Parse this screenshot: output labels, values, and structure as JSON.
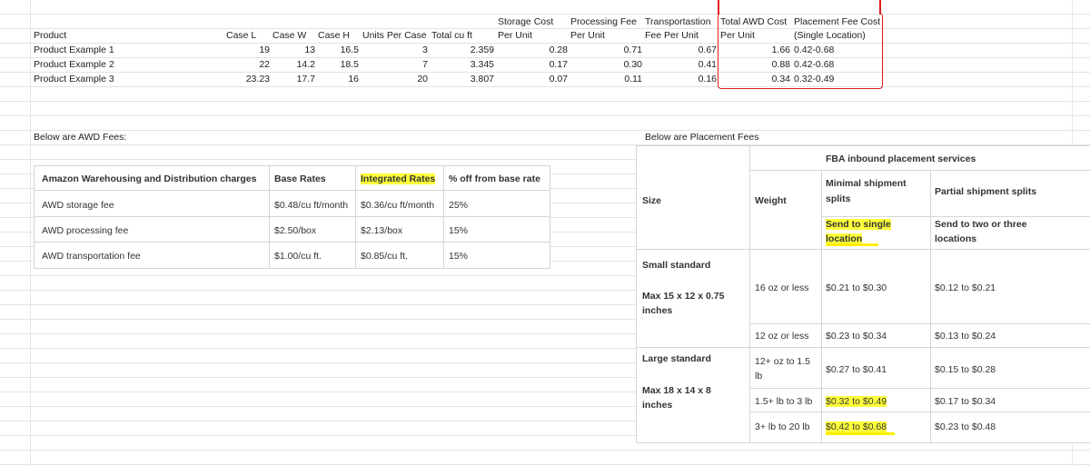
{
  "sheet": {
    "headers": {
      "product": "Product",
      "case_l": "Case L",
      "case_w": "Case W",
      "case_h": "Case H",
      "units": "Units Per Case",
      "total_cu": "Total cu ft",
      "storage_1": "Storage Cost",
      "storage_2": "Per Unit",
      "processing_1": "Processing Fee",
      "processing_2": "Per Unit",
      "transport_1": "Transportastion",
      "transport_2": "Fee Per Unit",
      "awd_1": "Total AWD Cost",
      "awd_2": "Per Unit",
      "placement_1": "Placement Fee Cost",
      "placement_2": "(Single Location)"
    },
    "rows": [
      {
        "product": "Product Example 1",
        "case_l": "19",
        "case_w": "13",
        "case_h": "16.5",
        "units": "3",
        "total_cu": "2.359",
        "storage": "0.28",
        "processing": "0.71",
        "transport": "0.67",
        "awd": "1.66",
        "placement": "0.42-0.68"
      },
      {
        "product": "Product Example 2",
        "case_l": "22",
        "case_w": "14.2",
        "case_h": "18.5",
        "units": "7",
        "total_cu": "3.345",
        "storage": "0.17",
        "processing": "0.30",
        "transport": "0.41",
        "awd": "0.88",
        "placement": "0.42-0.68"
      },
      {
        "product": "Product Example 3",
        "case_l": "23.23",
        "case_w": "17.7",
        "case_h": "16",
        "units": "20",
        "total_cu": "3.807",
        "storage": "0.07",
        "processing": "0.11",
        "transport": "0.16",
        "awd": "0.34",
        "placement": "0.32-0.49"
      }
    ],
    "below_awd": "Below are AWD Fees:",
    "below_placement": "Below are Placement Fees"
  },
  "awd_table": {
    "headers": [
      "Amazon Warehousing and Distribution charges",
      "Base Rates",
      "Integrated Rates",
      "% off from base rate"
    ],
    "rows": [
      [
        "AWD storage fee",
        "$0.48/cu ft/month",
        "$0.36/cu ft/month",
        "25%"
      ],
      [
        "AWD processing fee",
        "$2.50/box",
        "$2.13/box",
        "15%"
      ],
      [
        "AWD transportation fee",
        "$1.00/cu ft.",
        "$0.85/cu ft.",
        "15%"
      ]
    ]
  },
  "placement_table": {
    "title": "FBA inbound placement services",
    "size_label": "Size",
    "weight_label": "Weight",
    "minimal_1": "Minimal shipment",
    "minimal_2": "splits",
    "partial": "Partial shipment splits",
    "single_1": "Send to single",
    "single_2": "location",
    "multi_1": "Send to two or three",
    "multi_2": "locations",
    "small": {
      "name": "Small standard",
      "dims_1": "Max 15 x 12 x 0.75",
      "dims_2": "inches"
    },
    "large": {
      "name": "Large standard",
      "dims_1": "Max 18 x 14 x 8",
      "dims_2": "inches"
    },
    "rows": [
      {
        "weight": "16 oz or less",
        "single": "$0.21 to $0.30",
        "multi": "$0.12 to $0.21"
      },
      {
        "weight": "12 oz or less",
        "single": "$0.23 to $0.34",
        "multi": "$0.13 to $0.24"
      },
      {
        "weight_1": "12+ oz to 1.5",
        "weight_2": "lb",
        "single": "$0.27 to $0.41",
        "multi": "$0.15 to $0.28"
      },
      {
        "weight": "1.5+ lb to 3 lb",
        "single": "$0.32 to $0.49",
        "multi": "$0.17 to $0.34"
      },
      {
        "weight": "3+ lb to 20 lb",
        "single": "$0.42 to $0.68",
        "multi": "$0.23 to $0.48"
      }
    ]
  }
}
